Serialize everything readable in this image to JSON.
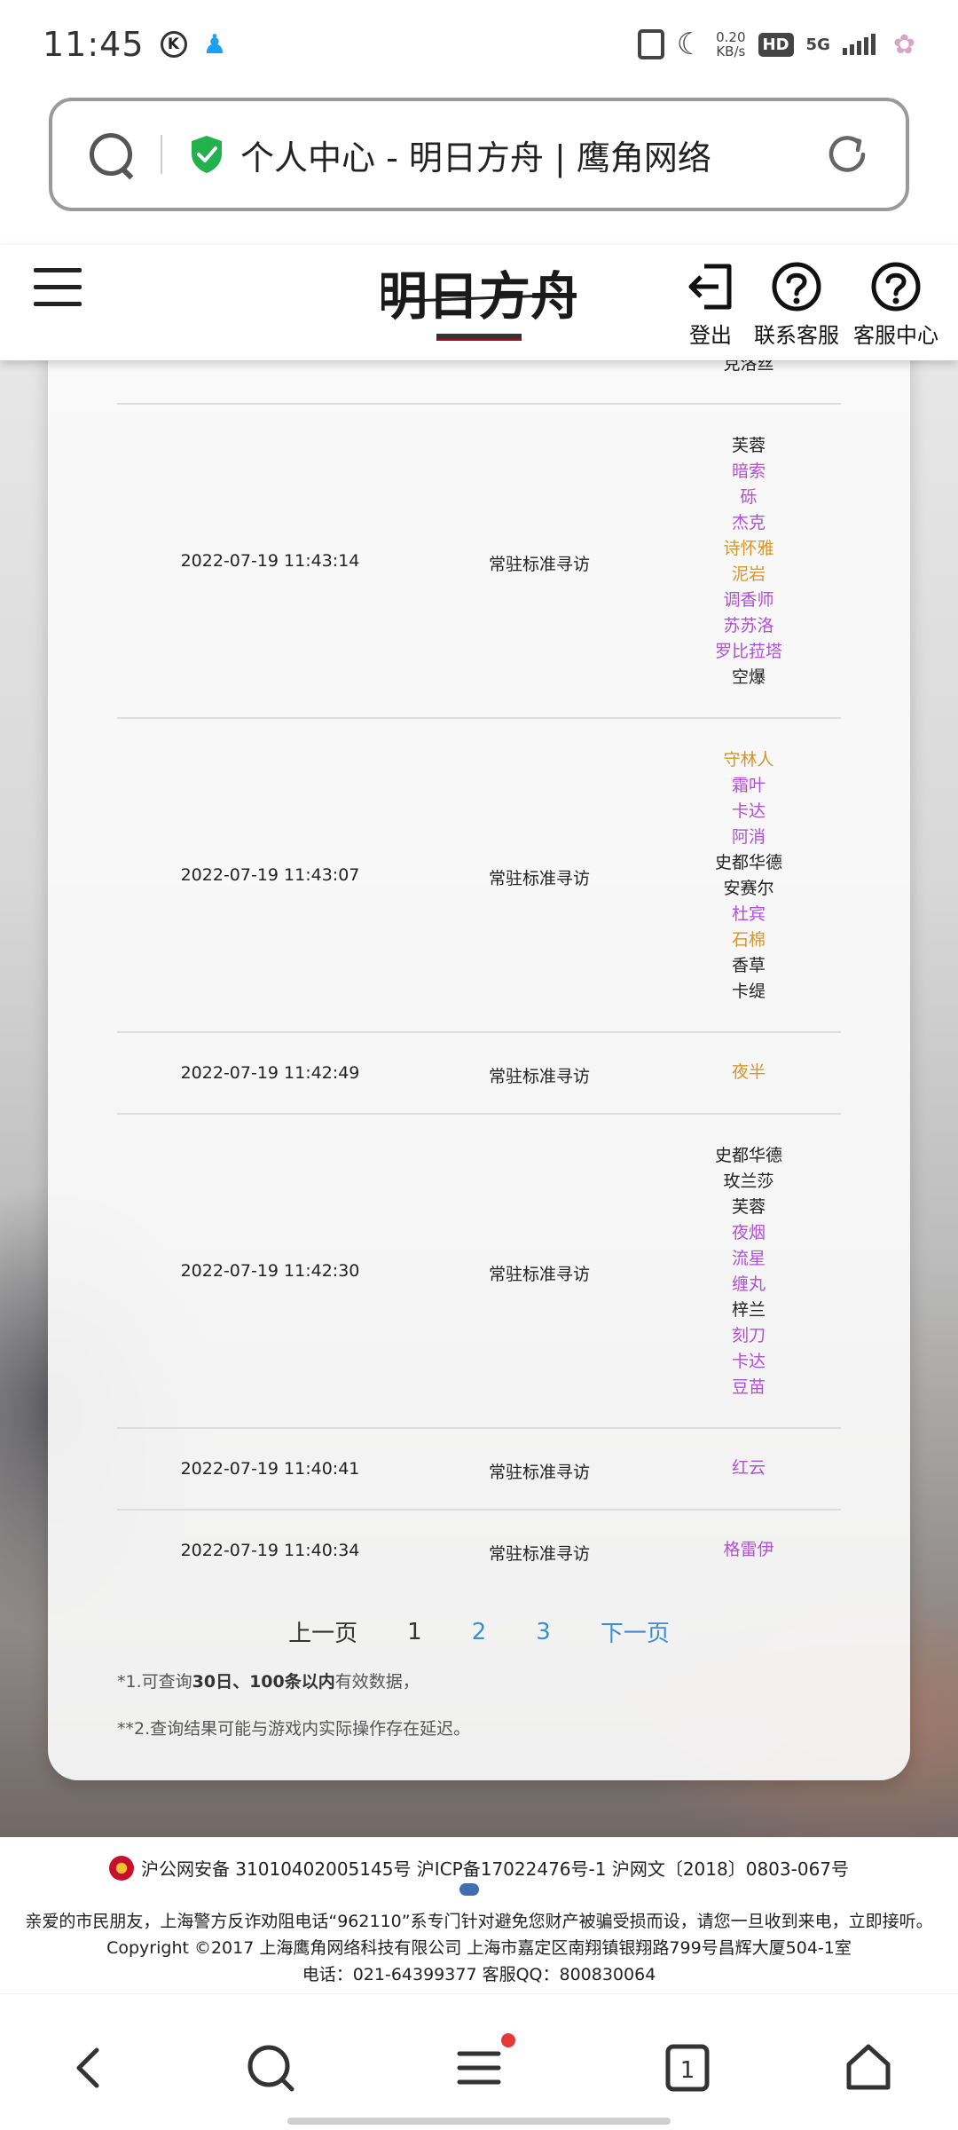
{
  "status_bar": {
    "time": "11:45",
    "k_badge": "K",
    "net_speed_value": "0.20",
    "net_speed_unit": "KB/s",
    "hd_label": "HD",
    "network_label": "5G"
  },
  "address_bar": {
    "page_title": "个人中心 - 明日方舟 | 鹰角网络"
  },
  "header": {
    "logout_label": "登出",
    "contact_label": "联系客服",
    "service_center_label": "客服中心"
  },
  "records": {
    "cut_top_operator": "克洛丝",
    "rows": [
      {
        "time": "2022-07-19 11:43:14",
        "type": "常驻标准寻访",
        "operators": [
          {
            "name": "芙蓉",
            "rarity": "r4"
          },
          {
            "name": "暗索",
            "rarity": "r5"
          },
          {
            "name": "砾",
            "rarity": "r5"
          },
          {
            "name": "杰克",
            "rarity": "r5"
          },
          {
            "name": "诗怀雅",
            "rarity": "r6"
          },
          {
            "name": "泥岩",
            "rarity": "r6"
          },
          {
            "name": "调香师",
            "rarity": "r5"
          },
          {
            "name": "苏苏洛",
            "rarity": "r5"
          },
          {
            "name": "罗比菈塔",
            "rarity": "r5"
          },
          {
            "name": "空爆",
            "rarity": "r4"
          }
        ]
      },
      {
        "time": "2022-07-19 11:43:07",
        "type": "常驻标准寻访",
        "operators": [
          {
            "name": "守林人",
            "rarity": "r6"
          },
          {
            "name": "霜叶",
            "rarity": "r5"
          },
          {
            "name": "卡达",
            "rarity": "r5"
          },
          {
            "name": "阿消",
            "rarity": "r5"
          },
          {
            "name": "史都华德",
            "rarity": "r4"
          },
          {
            "name": "安赛尔",
            "rarity": "r4"
          },
          {
            "name": "杜宾",
            "rarity": "r5"
          },
          {
            "name": "石棉",
            "rarity": "r6"
          },
          {
            "name": "香草",
            "rarity": "r4"
          },
          {
            "name": "卡缇",
            "rarity": "r4"
          }
        ]
      },
      {
        "time": "2022-07-19 11:42:49",
        "type": "常驻标准寻访",
        "operators": [
          {
            "name": "夜半",
            "rarity": "r6"
          }
        ]
      },
      {
        "time": "2022-07-19 11:42:30",
        "type": "常驻标准寻访",
        "operators": [
          {
            "name": "史都华德",
            "rarity": "r4"
          },
          {
            "name": "玫兰莎",
            "rarity": "r4"
          },
          {
            "name": "芙蓉",
            "rarity": "r4"
          },
          {
            "name": "夜烟",
            "rarity": "r5"
          },
          {
            "name": "流星",
            "rarity": "r5"
          },
          {
            "name": "缠丸",
            "rarity": "r5"
          },
          {
            "name": "梓兰",
            "rarity": "r4"
          },
          {
            "name": "刻刀",
            "rarity": "r5"
          },
          {
            "name": "卡达",
            "rarity": "r5"
          },
          {
            "name": "豆苗",
            "rarity": "r5"
          }
        ]
      },
      {
        "time": "2022-07-19 11:40:41",
        "type": "常驻标准寻访",
        "operators": [
          {
            "name": "红云",
            "rarity": "r5"
          }
        ]
      },
      {
        "time": "2022-07-19 11:40:34",
        "type": "常驻标准寻访",
        "operators": [
          {
            "name": "格雷伊",
            "rarity": "r5"
          }
        ]
      }
    ]
  },
  "pagination": {
    "prev_label": "上一页",
    "page_1": "1",
    "page_2": "2",
    "page_3": "3",
    "next_label": "下一页"
  },
  "notes": {
    "note1_prefix": "*1.可查询",
    "note1_bold": "30日、100条以内",
    "note1_suffix": "有效数据，",
    "note2": "**2.查询结果可能与游戏内实际操作存在延迟。"
  },
  "footer": {
    "line1": "沪公网安备 31010402005145号  沪ICP备17022476号-1  沪网文〔2018〕0803-067号",
    "line2": "亲爱的市民朋友，上海警方反诈劝阻电话“962110”系专门针对避免您财产被骗受损而设，请您一旦收到来电，立即接听。",
    "line3": "Copyright ©2017 上海鹰角网络科技有限公司  上海市嘉定区南翔镇银翔路799号昌辉大厦504-1室",
    "line4": "电话：021-64399377 客服QQ：800830064"
  },
  "bottom_nav": {
    "tabs_count": "1"
  },
  "colors": {
    "rarity_6": "#d5962a",
    "rarity_5": "#b050d6",
    "rarity_4": "#222222",
    "link": "#3d8ed0",
    "secure_shield": "#22b14c"
  }
}
